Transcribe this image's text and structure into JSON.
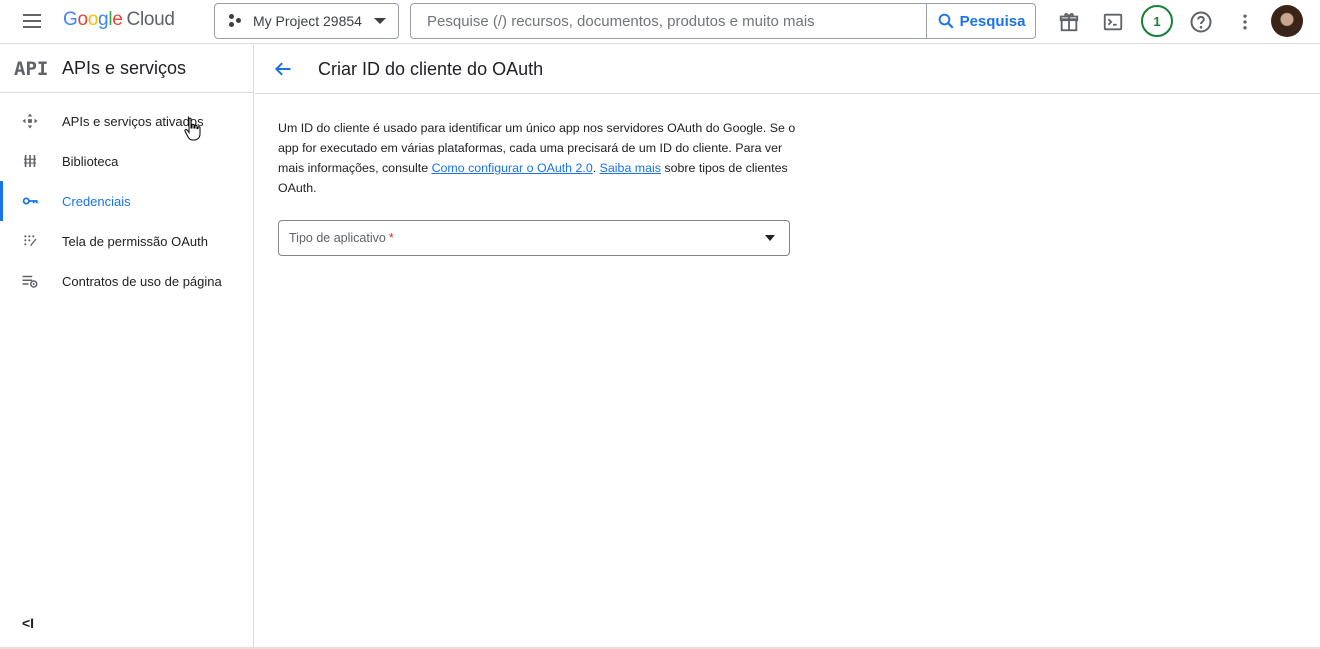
{
  "header": {
    "logo": {
      "google": "Google",
      "cloud": "Cloud"
    },
    "project": "My Project 29854",
    "search": {
      "placeholder": "Pesquise (/) recursos, documentos, produtos e muito mais",
      "button_label": "Pesquisa"
    },
    "notifications_count": "1",
    "icons": [
      "menu-icon",
      "gift-icon",
      "terminal-icon",
      "help-icon",
      "more-vert-icon",
      "account-avatar"
    ]
  },
  "sidebar": {
    "logo": "API",
    "title": "APIs e serviços",
    "items": [
      {
        "label": "APIs e serviços ativados",
        "icon": "apis-services-icon",
        "active": false
      },
      {
        "label": "Biblioteca",
        "icon": "library-icon",
        "active": false
      },
      {
        "label": "Credenciais",
        "icon": "key-icon",
        "active": true
      },
      {
        "label": "Tela de permissão OAuth",
        "icon": "consent-screen-icon",
        "active": false
      },
      {
        "label": "Contratos de uso de página",
        "icon": "page-usage-settings-icon",
        "active": false
      }
    ],
    "collapse_label": "<I"
  },
  "main": {
    "title": "Criar ID do cliente do OAuth",
    "description": {
      "text_1": "Um ID do cliente é usado para identificar um único app nos servidores OAuth do Google. Se o app for executado em várias plataformas, cada uma precisará de um ID do cliente. Para ver mais informações, consulte ",
      "link_1": "Como configurar o OAuth 2.0",
      "text_2": ". ",
      "link_2": "Saiba mais",
      "text_3": " sobre tipos de clientes OAuth."
    },
    "app_type_field": {
      "label": "Tipo de aplicativo",
      "required_mark": "*"
    }
  },
  "colors": {
    "accent": "#1a73e8",
    "badge": "#188038",
    "required": "#d93025"
  }
}
